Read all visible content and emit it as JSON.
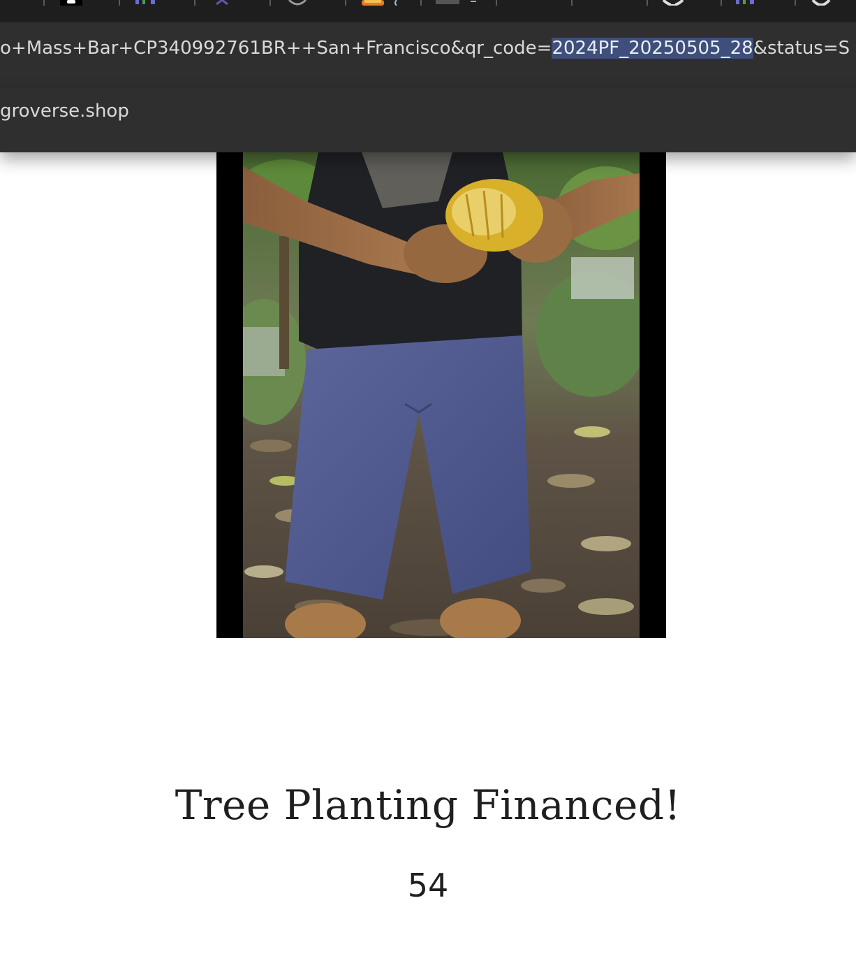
{
  "browser": {
    "url_before_selection": "o+Mass+Bar+CP340992761BR++San+Francisco&qr_code=",
    "url_selected": "2024PF_20250505_28",
    "url_after_selection": "&status=S",
    "suggestion": "groverse.shop"
  },
  "page": {
    "heading": "Tree Planting Financed!",
    "count": "54"
  },
  "colors": {
    "tabstrip": "#1e1e1e",
    "urlbar": "#2f2f2f",
    "selection": "#3d4f7a",
    "text": "#1f1f1f"
  }
}
